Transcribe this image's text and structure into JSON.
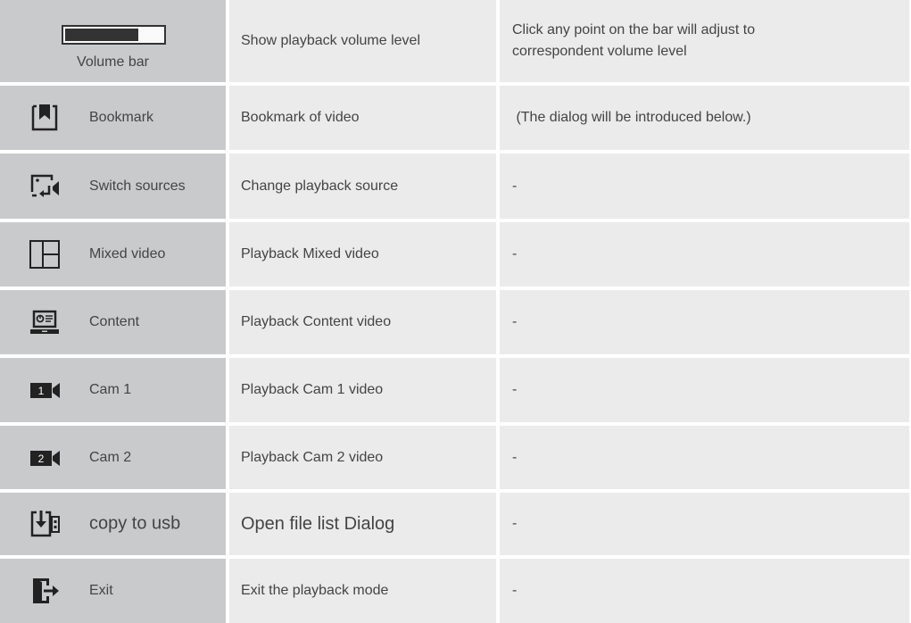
{
  "volume_row": {
    "label": "Volume bar",
    "description": "Show playback volume level",
    "note": "Click any point on the bar will adjust to correspondent volume level",
    "volume_level": 0.75
  },
  "rows": [
    {
      "icon": "bookmark-icon",
      "label": "Bookmark",
      "description": "Bookmark of video",
      "note": " (The dialog will be introduced below.)"
    },
    {
      "icon": "switch-sources-icon",
      "label": "Switch sources",
      "description": "Change playback source",
      "note": "-"
    },
    {
      "icon": "mixed-video-icon",
      "label": "Mixed video",
      "description": "Playback Mixed video",
      "note": "-"
    },
    {
      "icon": "content-icon",
      "label": "Content",
      "description": "Playback Content video",
      "note": "-"
    },
    {
      "icon": "cam1-icon",
      "label": "Cam 1",
      "description": "Playback Cam 1 video",
      "note": "-",
      "icon_text": "1"
    },
    {
      "icon": "cam2-icon",
      "label": "Cam 2",
      "description": "Playback Cam 2 video",
      "note": "-",
      "icon_text": "2"
    },
    {
      "icon": "copy-to-usb-icon",
      "label": "copy to usb",
      "description": "Open file list Dialog",
      "note": "-"
    },
    {
      "icon": "exit-icon",
      "label": "Exit",
      "description": "Exit the playback mode",
      "note": "-"
    }
  ]
}
